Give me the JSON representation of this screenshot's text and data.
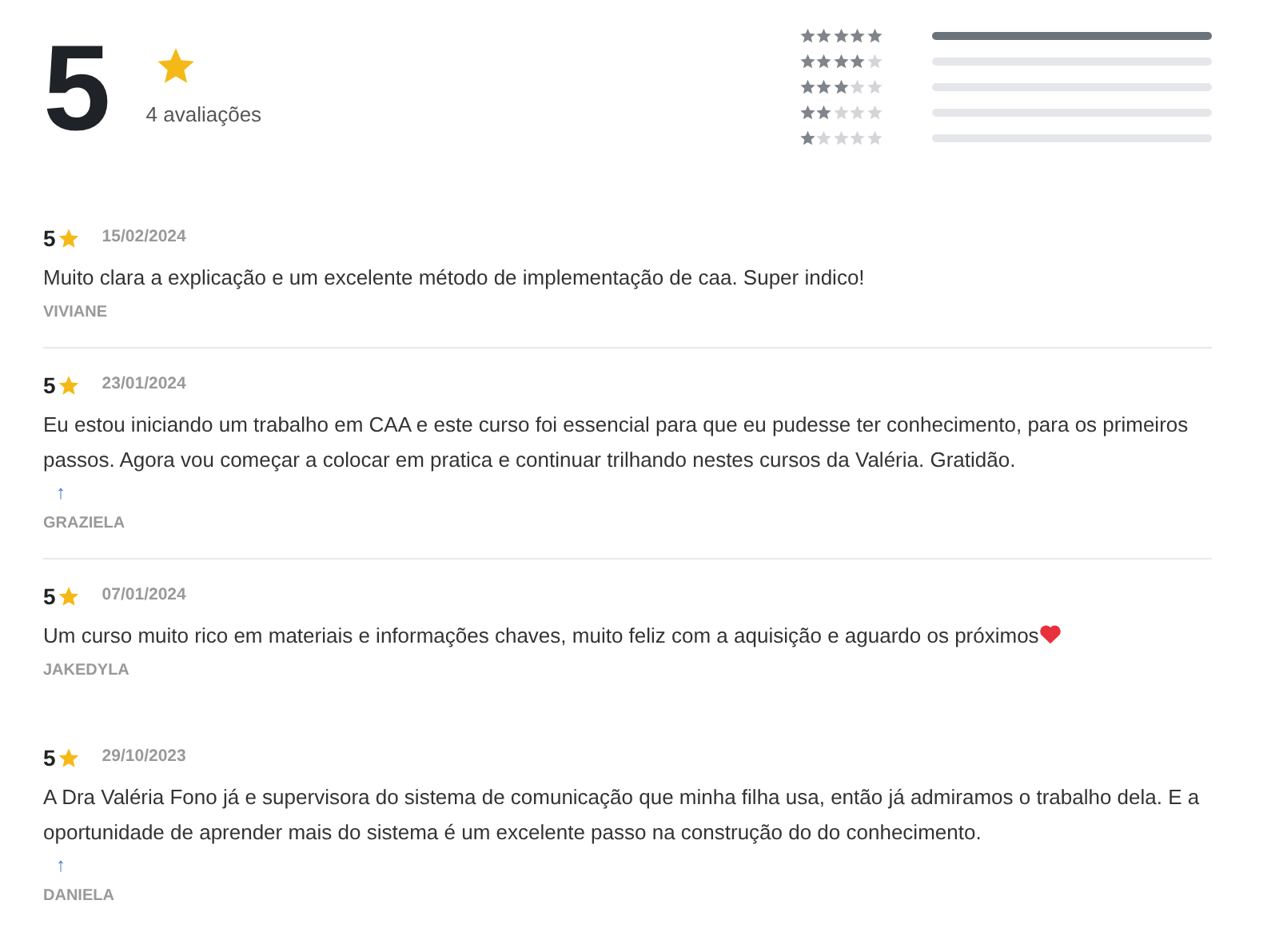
{
  "summary": {
    "score": "5",
    "count": "4 avaliações"
  },
  "distribution": [
    {
      "stars": 5,
      "level": 1
    },
    {
      "stars": 4,
      "level": 0
    },
    {
      "stars": 3,
      "level": 0
    },
    {
      "stars": 2,
      "level": 0
    },
    {
      "stars": 1,
      "level": 0
    }
  ],
  "reviews": [
    {
      "rating": "5",
      "date": "15/02/2024",
      "text": "Muito clara a explicação e um excelente método de implementação de caa. Super indico!",
      "heart": false,
      "author": "VIVIANE",
      "divider": true
    },
    {
      "rating": "5",
      "date": "23/01/2024",
      "text": "Eu estou iniciando um trabalho em CAA e este curso foi essencial para que eu pudesse ter conhecimento, para os primeiros passos. Agora vou começar a colocar em pratica e continuar trilhando nestes cursos da Valéria. Gratidão.",
      "arrow": "↑",
      "heart": false,
      "author": "GRAZIELA",
      "divider": true
    },
    {
      "rating": "5",
      "date": "07/01/2024",
      "text": "Um curso muito rico em materiais e informações chaves, muito feliz com a aquisição e aguardo os próximos",
      "heart": true,
      "author": "JAKEDYLA",
      "divider": false
    },
    {
      "rating": "5",
      "date": "29/10/2023",
      "text": "A Dra Valéria Fono já e supervisora do sistema de comunicação que minha filha usa, então já admiramos o trabalho dela. E a oportunidade de aprender mais do sistema é um excelente passo na construção do do conhecimento.",
      "arrow": "↑",
      "heart": false,
      "author": "DANIELA",
      "divider": false
    }
  ]
}
